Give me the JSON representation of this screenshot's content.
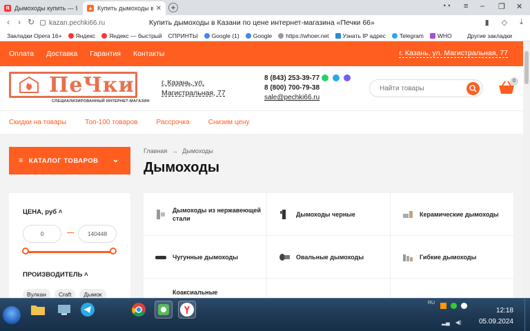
{
  "browser": {
    "tabs": [
      {
        "title": "Дымоходы купить — Янде",
        "active": false
      },
      {
        "title": "Купить дымоходы в Ка",
        "active": true
      }
    ],
    "url": "kazan.pechki66.ru",
    "page_title": "Купить дымоходы в Казани по цене интернет-магазина «Печки 66»",
    "bookmarks": [
      "Закладки Opera 16+",
      "Яндекс",
      "Яндекс — быстрый",
      "СПРИНТЫ",
      "Google (1)",
      "Google",
      "https://whoer.net",
      "Узнать IP адрес",
      "Telegram",
      "WHO"
    ],
    "other_bookmarks": "Другие закладки"
  },
  "site": {
    "topnav": [
      "Оплата",
      "Доставка",
      "Гарантия",
      "Контакты"
    ],
    "topnav_city": "г. Казань, ул. Магистральная, 77",
    "logo_brand": "ПеЧки",
    "logo_sub": "СПЕЦИАЛИЗИРОВАННЫЙ ИНТЕРНЕТ-МАГАЗИН",
    "header_city": "г. Казань, ул. Магистральная, 77",
    "phone1": "8 (843) 253-39-77",
    "phone2": "8 (800) 700-79-38",
    "email": "sale@pechki66.ru",
    "search_placeholder": "Найти товары",
    "cart_count": "0",
    "subnav": [
      "Скидки на товары",
      "Топ-100 товаров",
      "Рассрочка",
      "Снизим цену"
    ],
    "catalog_button": "КАТАЛОГ ТОВАРОВ",
    "breadcrumb": {
      "home": "Главная",
      "arrow": "→",
      "current": "Дымоходы"
    },
    "heading": "Дымоходы",
    "filter": {
      "price_label": "ЦЕНА, руб",
      "price_min": "0",
      "price_max": "140448",
      "price_dash": "—",
      "maker_label": "ПРОИЗВОДИТЕЛЬ",
      "makers": [
        "Вулкан",
        "Craft",
        "Дымок"
      ]
    },
    "categories": [
      "Дымоходы из нержавеющей стали",
      "Дымоходы черные",
      "Керамические дымоходы",
      "Чугунные дымоходы",
      "Овальные дымоходы",
      "Гибкие дымоходы",
      "Коаксиальные"
    ]
  },
  "taskbar": {
    "lang": "RU",
    "time": "12:18",
    "date": "05.09.2024"
  },
  "colors": {
    "accent": "#ff5e20",
    "logo": "#e8704c"
  }
}
